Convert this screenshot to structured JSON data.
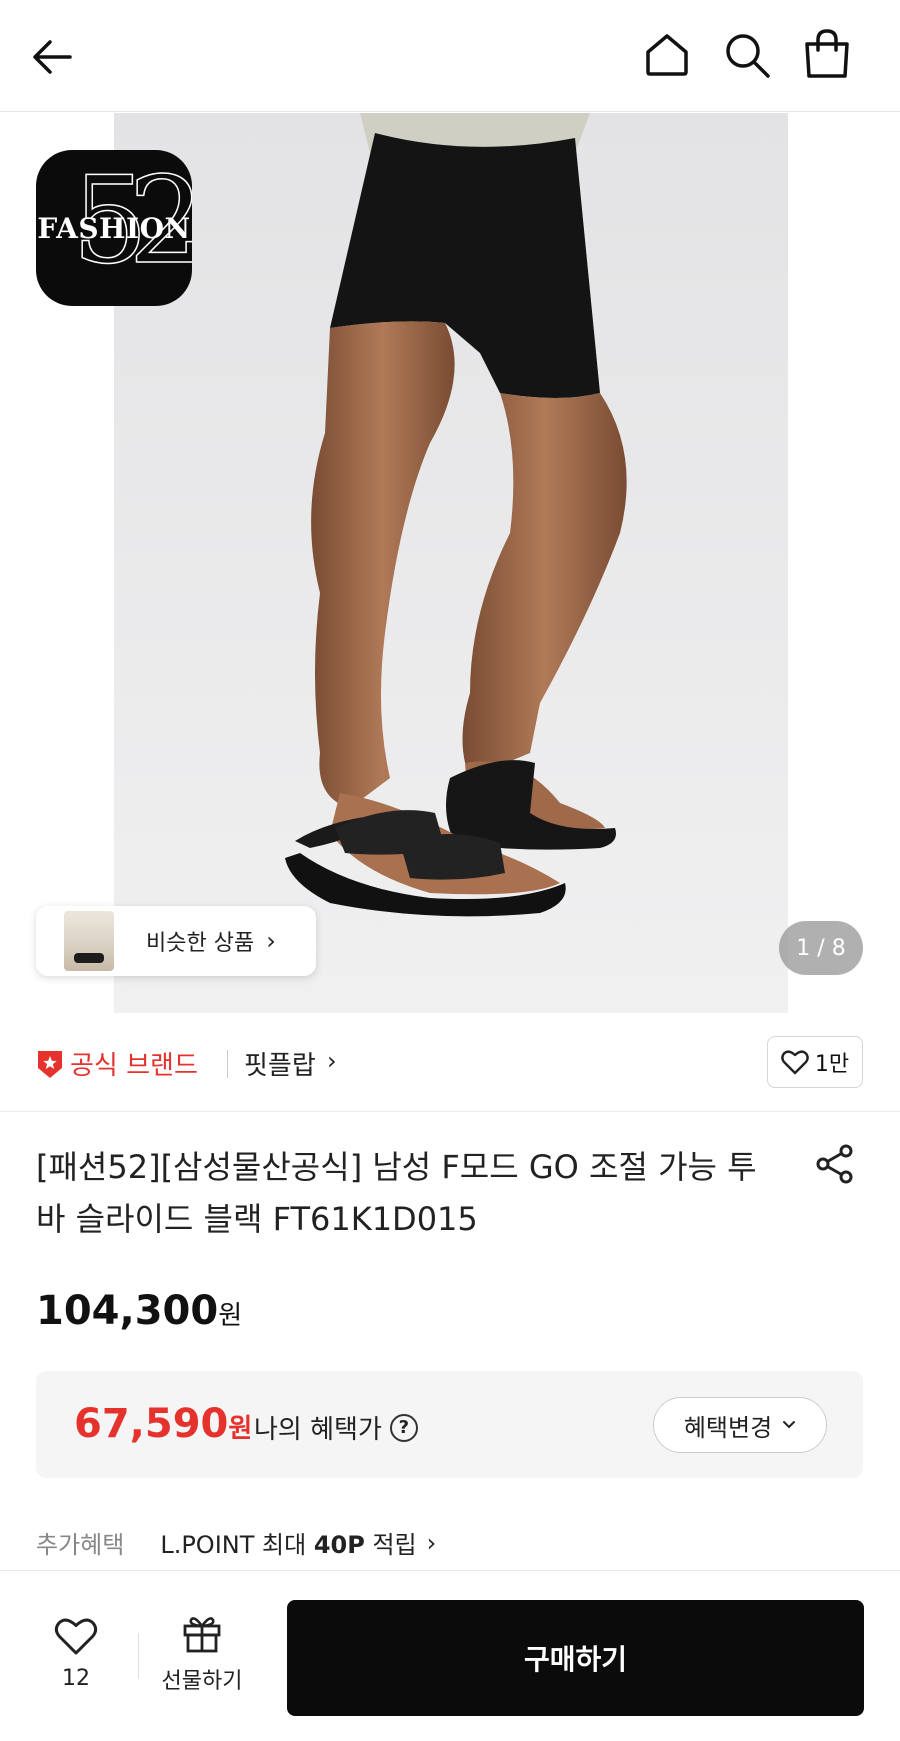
{
  "header": {
    "back_icon": "arrow-left-icon",
    "home_icon": "home-icon",
    "search_icon": "search-icon",
    "bag_icon": "shopping-bag-icon"
  },
  "hero": {
    "brand_logo_text": "FASHION",
    "brand_logo_number": "52",
    "similar_label": "비슷한 상품",
    "similar_chevron": "›",
    "pager": "1 / 8"
  },
  "brand": {
    "official_label": "공식 브랜드",
    "brand_name": "핏플랍",
    "brand_chevron": "›",
    "likes": "1만",
    "accent": "#e5322d"
  },
  "product": {
    "title": "[패션52][삼성물산공식] 남성 F모드 GO 조절 가능 투 바 슬라이드 블랙 FT61K1D015",
    "price": "104,300",
    "price_unit": "원"
  },
  "benefit": {
    "price": "67,590",
    "unit": "원",
    "label": "나의 혜택가",
    "help": "?",
    "change_button": "혜택변경"
  },
  "extra": {
    "key": "추가혜택",
    "prefix": "L.POINT 최대 ",
    "points": "40P",
    "suffix": " 적립",
    "chevron": "›"
  },
  "bottom": {
    "wish_count": "12",
    "gift_label": "선물하기",
    "buy_label": "구매하기"
  }
}
